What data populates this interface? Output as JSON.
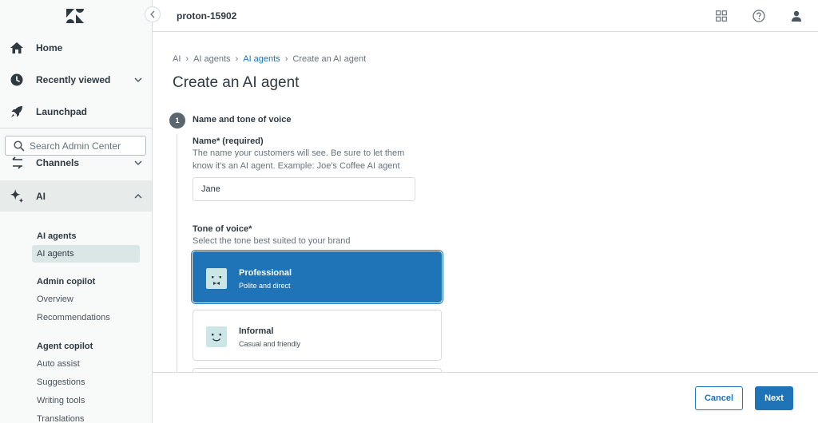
{
  "sidebar": {
    "collapse_label": "Collapse",
    "nav": {
      "home": "Home",
      "recently_viewed": "Recently viewed",
      "launchpad": "Launchpad",
      "channels": "Channels",
      "ai": "AI"
    },
    "search_placeholder": "Search Admin Center",
    "sections": {
      "ai_agents_heading": "AI agents",
      "ai_agents_item": "AI agents",
      "admin_copilot_heading": "Admin copilot",
      "overview": "Overview",
      "recommendations": "Recommendations",
      "agent_copilot_heading": "Agent copilot",
      "auto_assist": "Auto assist",
      "suggestions": "Suggestions",
      "writing_tools": "Writing tools",
      "translations": "Translations"
    }
  },
  "header": {
    "account": "proton-15902",
    "icons": [
      "products-grid-icon",
      "help-icon",
      "user-profile-icon"
    ]
  },
  "breadcrumb": [
    "AI",
    "AI agents",
    "AI agents",
    "Create an AI agent"
  ],
  "page": {
    "title": "Create an AI agent",
    "step": {
      "number": "1",
      "title": "Name and tone of voice"
    },
    "name_field": {
      "label": "Name* (required)",
      "hint": "The name your customers will see. Be sure to let them know it's an AI agent. Example: Joe's Coffee AI agent",
      "value": "Jane"
    },
    "tone_field": {
      "label": "Tone of voice*",
      "hint": "Select the tone best suited to your brand",
      "options": [
        {
          "name": "Professional",
          "description": "Polite and direct",
          "selected": true
        },
        {
          "name": "Informal",
          "description": "Casual and friendly",
          "selected": false
        }
      ]
    }
  },
  "footer": {
    "cancel": "Cancel",
    "next": "Next"
  },
  "colors": {
    "accent": "#1f73b7",
    "sidebar_bg": "#f8f9f9",
    "active_bg": "#e7eceb",
    "face_bg": "#cbe7e5"
  }
}
